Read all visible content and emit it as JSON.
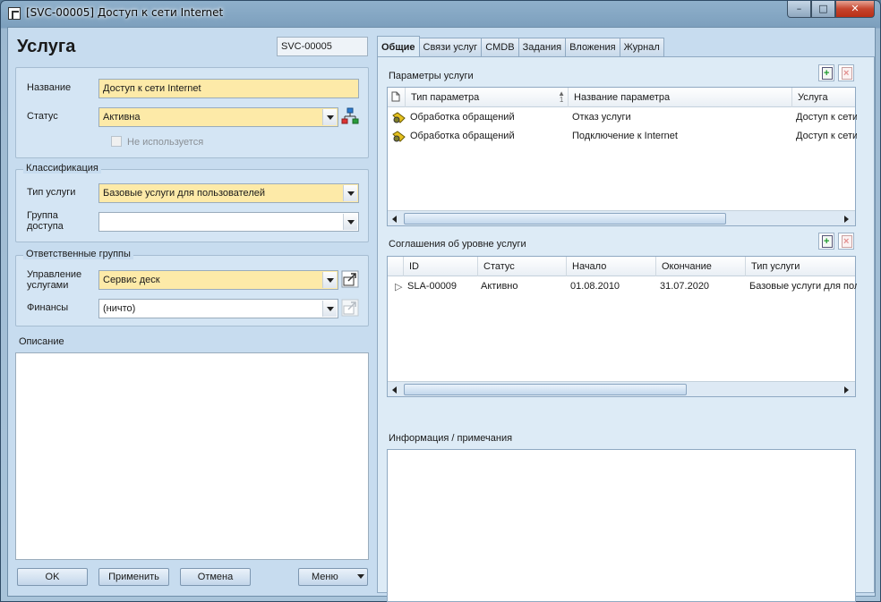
{
  "window": {
    "title": "[SVC-00005] Доступ к сети Internet",
    "controls": {
      "minimize": "–",
      "maximize": "□",
      "close": "✕"
    }
  },
  "header": {
    "title": "Услуга",
    "code": "SVC-00005"
  },
  "general": {
    "name_label": "Название",
    "name_value": "Доступ к сети Internet",
    "status_label": "Статус",
    "status_value": "Активна",
    "unused_label": "Не используется"
  },
  "classification": {
    "legend": "Классификация",
    "type_label": "Тип услуги",
    "type_value": "Базовые услуги для пользователей",
    "access_label_1": "Группа",
    "access_label_2": "доступа",
    "access_value": ""
  },
  "responsible": {
    "legend": "Ответственные группы",
    "mgmt_label_1": "Управление",
    "mgmt_label_2": "услугами",
    "mgmt_value": "Сервис деск",
    "finance_label": "Финансы",
    "finance_value": "(ничто)"
  },
  "description": {
    "label": "Описание",
    "value": ""
  },
  "buttons": {
    "ok": "OK",
    "apply": "Применить",
    "cancel": "Отмена",
    "menu": "Меню"
  },
  "tabs": [
    "Общие",
    "Связи услуг",
    "CMDB",
    "Задания",
    "Вложения",
    "Журнал"
  ],
  "params": {
    "label": "Параметры услуги",
    "sort_indicator": "1",
    "columns": [
      "Тип параметра",
      "Название параметра",
      "Услуга"
    ],
    "rows": [
      {
        "type": "Обработка обращений",
        "name": "Отказ услуги",
        "service": "Доступ к сети Internet"
      },
      {
        "type": "Обработка обращений",
        "name": "Подключение к Internet",
        "service": "Доступ к сети Internet"
      }
    ]
  },
  "sla": {
    "label": "Соглашения об уровне услуги",
    "columns": [
      "ID",
      "Статус",
      "Начало",
      "Окончание",
      "Тип услуги"
    ],
    "rows": [
      {
        "id": "SLA-00009",
        "status": "Активно",
        "start": "01.08.2010",
        "end": "31.07.2020",
        "type": "Базовые услуги для пользователей"
      }
    ]
  },
  "notes": {
    "label": "Информация / примечания",
    "value": ""
  },
  "colors": {
    "required_field": "#fdeaa8",
    "panel": "#c7dcef",
    "tabpage": "#ddebf6"
  }
}
